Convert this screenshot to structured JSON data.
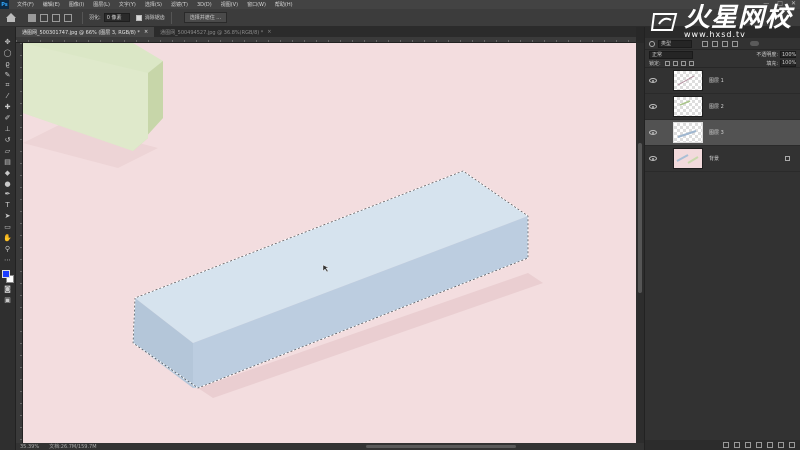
{
  "menubar": {
    "logo": "Ps",
    "items": [
      "文件(F)",
      "编辑(E)",
      "图像(I)",
      "图层(L)",
      "文字(Y)",
      "选择(S)",
      "滤镜(T)",
      "3D(D)",
      "视图(V)",
      "窗口(W)",
      "帮助(H)"
    ],
    "window_controls": [
      "—",
      "□",
      "✕"
    ]
  },
  "options": {
    "feather_label": "羽化:",
    "feather_value": "0 像素",
    "antialias_label": "消除锯齿",
    "select_mask_button": "选择并遮住 ..."
  },
  "tabs": [
    {
      "label": "通图网_500301747.jpg @ 66% (图层 3, RGB/8) *",
      "active": true,
      "close": "×"
    },
    {
      "label": "通图网_500494527.jpg @ 36.8%(RGB/8) *",
      "active": false,
      "close": "×"
    }
  ],
  "status": {
    "zoom": "35.39%",
    "doc_info": "文档:26.7M/159.7M"
  },
  "layers_panel": {
    "kind_label": "类型",
    "blend_mode": "正常",
    "opacity_label": "不透明度:",
    "opacity_value": "100%",
    "lock_label": "锁定:",
    "fill_label": "填充:",
    "fill_value": "100%",
    "layers": [
      {
        "name": "图层 1",
        "selected": false
      },
      {
        "name": "图层 2",
        "selected": false
      },
      {
        "name": "图层 3",
        "selected": true
      },
      {
        "name": "背景",
        "selected": false
      }
    ]
  },
  "watermark": {
    "title": "火星网校",
    "url": "www.hxsd.tv"
  },
  "colors": {
    "canvas_bg": "#f3dddf",
    "block_top": "#d5e2ec",
    "block_side": "#b3c6d9",
    "green_top": "#dfe9c9",
    "foreground": "#1a3cff",
    "background": "#ffffff"
  },
  "icons": [
    "move-icon",
    "marquee-icon",
    "lasso-icon",
    "quick-select-icon",
    "crop-icon",
    "eyedropper-icon",
    "healing-icon",
    "brush-icon",
    "stamp-icon",
    "history-brush-icon",
    "eraser-icon",
    "gradient-icon",
    "blur-icon",
    "dodge-icon",
    "pen-icon",
    "type-icon",
    "path-select-icon",
    "shape-icon",
    "hand-icon",
    "zoom-icon",
    "more-icon"
  ]
}
